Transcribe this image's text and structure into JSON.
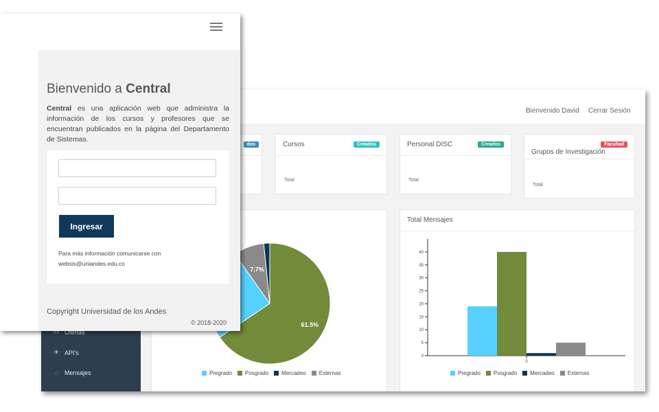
{
  "header": {
    "greeting": "Bienvenido David",
    "logout": "Cerrar Sesión"
  },
  "colors": {
    "pregrado": "#55d0ff",
    "posgrado": "#718b3a",
    "mercadeo": "#0f3551",
    "externas": "#8a8a8a",
    "sidebar": "#2c3e50",
    "login_button": "#11385b"
  },
  "cards": [
    {
      "title": "",
      "badge": "dos",
      "badge_color": "#3c8dbc",
      "total": ""
    },
    {
      "title": "Cursos",
      "badge": "Creados",
      "badge_color": "#2bc0c4",
      "total": "Total"
    },
    {
      "title": "Personal DISC",
      "badge": "Creados",
      "badge_color": "#26a98f",
      "total": "Total"
    },
    {
      "title": "Grupos de Investigación",
      "badge": "Facultad",
      "badge_color": "#e8535e",
      "total": "Total"
    }
  ],
  "sidebar": {
    "items": [
      {
        "label": "Ofertas",
        "icon": "briefcase-icon"
      },
      {
        "label": "API's",
        "icon": "plane-icon"
      },
      {
        "label": "Mensajes",
        "icon": "chat-icon"
      }
    ]
  },
  "login": {
    "title_prefix": "Bienvenido a ",
    "title_strong": "Central",
    "desc_strong": "Central",
    "desc_rest": " es una aplicación web que administra la información de los cursos y profesores que se encuentran publicados en la página del Departamento de Sistemas.",
    "username_value": "",
    "password_value": "",
    "button": "Ingresar",
    "info_line1": "Para más información comunicarse con",
    "info_line2": "websis@uniandes.edu.co",
    "copyright": "Copyright Universidad de los Andes",
    "year": "© 2018-2020"
  },
  "chart_data": [
    {
      "type": "pie",
      "title": "",
      "slices": [
        {
          "label": "Pregrado",
          "value": 23.1
        },
        {
          "label": "Posgrado",
          "value": 61.5,
          "data_label": "61.5%"
        },
        {
          "label": "Mercadeo",
          "value": 1.5
        },
        {
          "label": "Externas",
          "value": 7.7,
          "data_label": "7.7%"
        }
      ],
      "legend": [
        "Pregrado",
        "Posgrado",
        "Mercadeo",
        "Externas"
      ],
      "legend_placement": "bottom"
    },
    {
      "type": "bar",
      "title": "Total Mensajes",
      "categories": [
        "0"
      ],
      "series": [
        {
          "name": "Pregrado",
          "values": [
            19
          ]
        },
        {
          "name": "Posgrado",
          "values": [
            40
          ]
        },
        {
          "name": "Mercadeo",
          "values": [
            1
          ]
        },
        {
          "name": "Externas",
          "values": [
            5
          ]
        }
      ],
      "yticks": [
        "0",
        "5",
        "10",
        "15",
        "20",
        "25",
        "30",
        "35",
        "40"
      ],
      "ylim": [
        0,
        45
      ],
      "grid": false,
      "legend_placement": "bottom"
    }
  ]
}
